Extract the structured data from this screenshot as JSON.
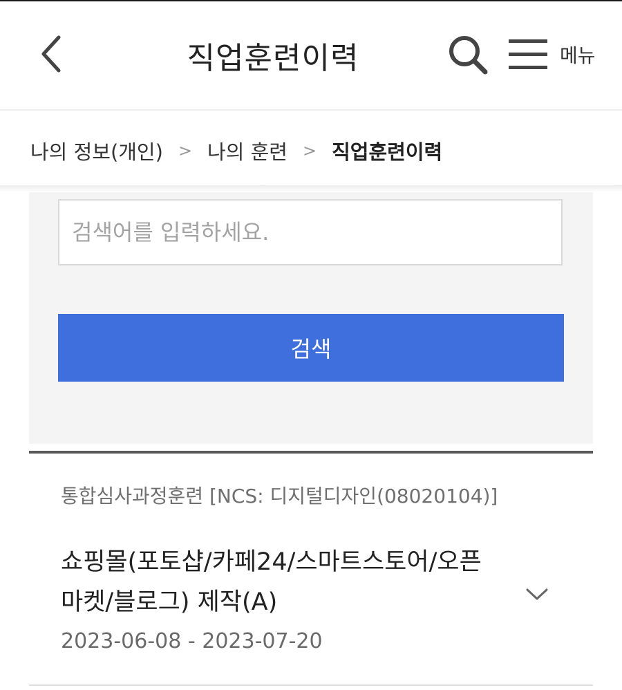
{
  "header": {
    "title": "직업훈련이력",
    "menu_label": "메뉴",
    "icons": {
      "back": "chevron-left-icon",
      "search": "search-icon",
      "menu": "hamburger-menu-icon"
    }
  },
  "breadcrumb": {
    "items": [
      "나의 정보(개인)",
      "나의 훈련",
      "직업훈련이력"
    ]
  },
  "search": {
    "placeholder": "검색어를 입력하세요.",
    "value": "",
    "button_label": "검색"
  },
  "results": [
    {
      "category": "통합심사과정훈련 [NCS: 디지털디자인(08020104)]",
      "title": "쇼핑몰(포토샵/카페24/스마트스토어/오픈마켓/블로그) 제작(A)",
      "period": "2023-06-08 - 2023-07-20"
    }
  ],
  "colors": {
    "primary": "#3f6fdc",
    "panel_bg": "#f4f4f4",
    "text": "#222222",
    "muted": "#6f6f6f"
  }
}
